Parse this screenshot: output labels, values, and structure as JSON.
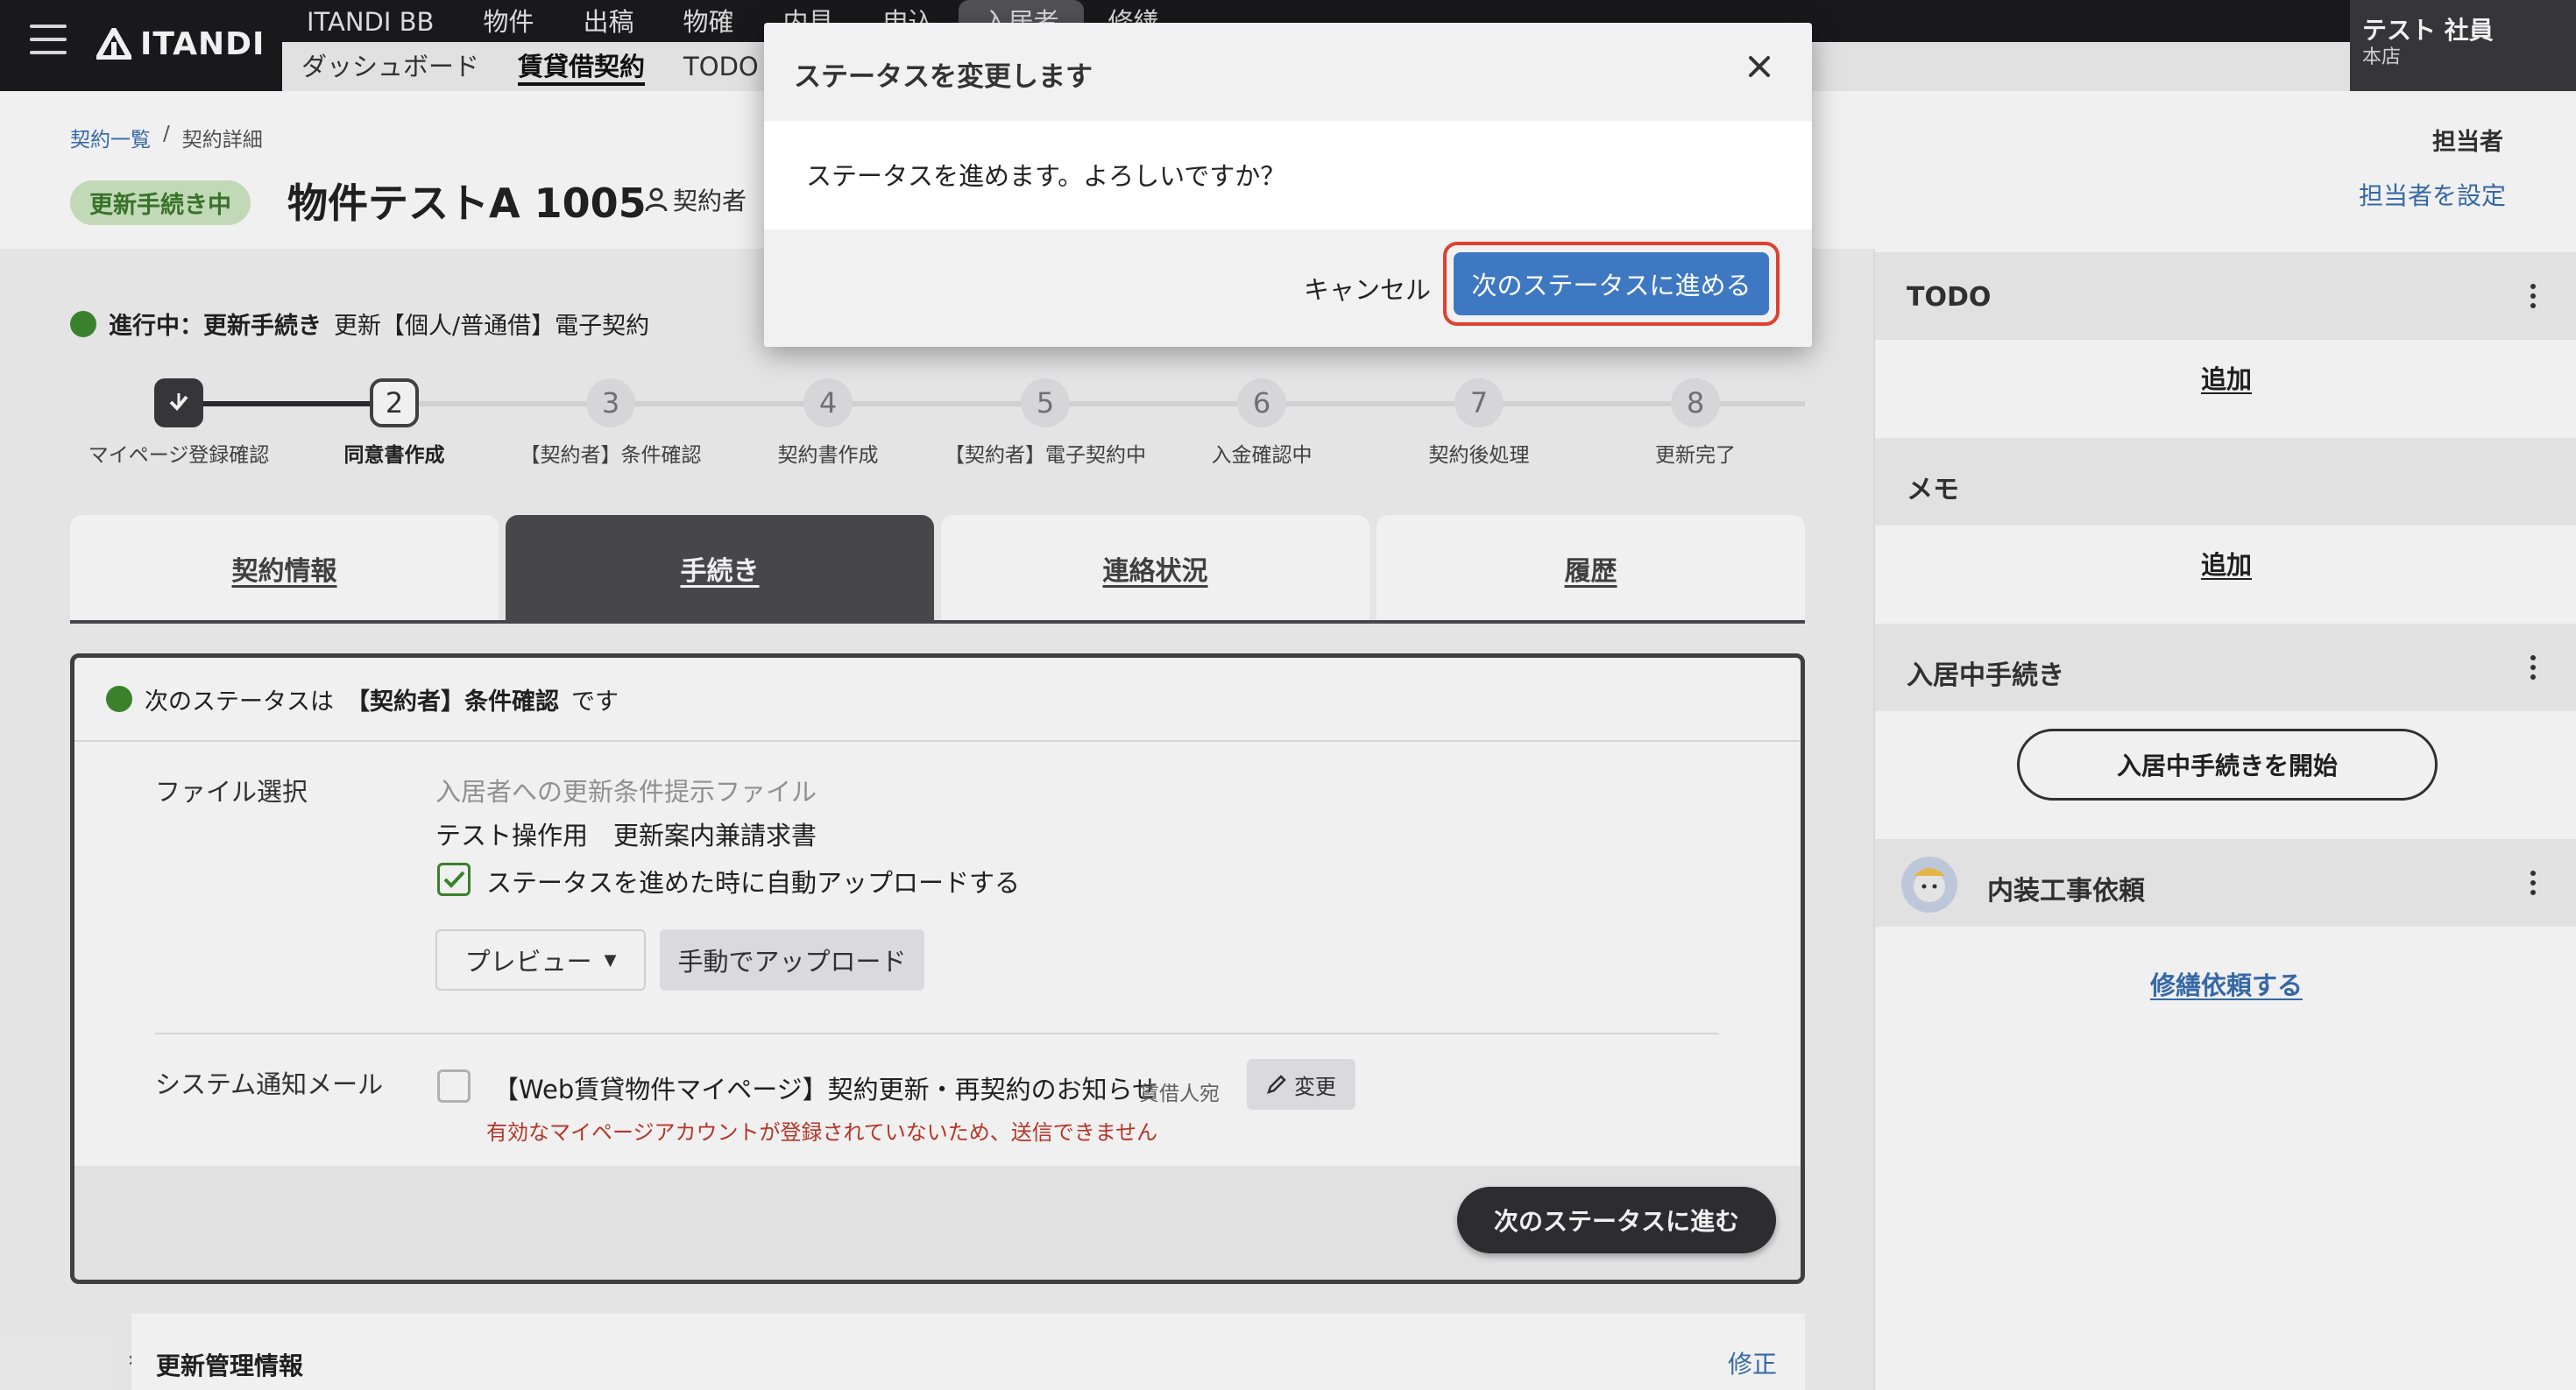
{
  "header": {
    "logo_text": "ITANDI",
    "nav_primary": [
      "ITANDI BB",
      "物件",
      "出稿",
      "物確",
      "内見",
      "申込",
      "入居者",
      "修繕"
    ],
    "nav_primary_active": 6,
    "nav_secondary": [
      "ダッシュボード",
      "賃貸借契約",
      "TODO"
    ],
    "nav_secondary_active": 1,
    "user_name": "テスト 社員",
    "user_branch": "本店"
  },
  "page": {
    "breadcrumb_list": "契約一覧",
    "breadcrumb_sep": "/",
    "breadcrumb_detail": "契約詳細",
    "status_chip": "更新手続き中",
    "title": "物件テストA 1005",
    "contractor_label": "契約者",
    "assignee_title": "担当者",
    "assignee_link": "担当者を設定"
  },
  "progress": {
    "state_label": "進行中：更新手続き",
    "state_detail": "更新【個人/普通借】電子契約",
    "steps": [
      {
        "num": "",
        "label": "マイページ登録確認",
        "state": "done"
      },
      {
        "num": "2",
        "label": "同意書作成",
        "state": "current"
      },
      {
        "num": "3",
        "label": "【契約者】条件確認",
        "state": "todo"
      },
      {
        "num": "4",
        "label": "契約書作成",
        "state": "todo"
      },
      {
        "num": "5",
        "label": "【契約者】電子契約中",
        "state": "todo"
      },
      {
        "num": "6",
        "label": "入金確認中",
        "state": "todo"
      },
      {
        "num": "7",
        "label": "契約後処理",
        "state": "todo"
      },
      {
        "num": "8",
        "label": "更新完了",
        "state": "todo"
      }
    ]
  },
  "tabs": [
    "契約情報",
    "手続き",
    "連絡状況",
    "履歴"
  ],
  "tabs_active": 1,
  "card": {
    "next_prefix": "次のステータスは",
    "next_status": "【契約者】条件確認",
    "next_suffix": "です",
    "file_label": "ファイル選択",
    "file_hint": "入居者への更新条件提示ファイル",
    "file_name": "テスト操作用　更新案内兼請求書",
    "auto_upload_label": "ステータスを進めた時に自動アップロードする",
    "auto_upload_checked": true,
    "preview_button": "プレビュー",
    "manual_upload_button": "手動でアップロード",
    "mail_label": "システム通知メール",
    "mail_title": "【Web賃貸物件マイページ】契約更新・再契約のお知らせ",
    "mail_recipient": "賃借人宛",
    "mail_change_button": "変更",
    "mail_warning": "有効なマイページアカウントが登録されていないため、送信できません",
    "mail_checked": false,
    "advance_button": "次のステータスに進む"
  },
  "bottom_section": {
    "title": "更新管理情報",
    "edit": "修正"
  },
  "sidebar": {
    "todo_title": "TODO",
    "todo_add": "追加",
    "memo_title": "メモ",
    "memo_add": "追加",
    "movein_title": "入居中手続き",
    "movein_button": "入居中手続きを開始",
    "interior_title": "内装工事依頼",
    "interior_link": "修繕依頼する"
  },
  "modal": {
    "title": "ステータスを変更します",
    "message": "ステータスを進めます。よろしいですか？",
    "cancel": "キャンセル",
    "confirm": "次のステータスに進める"
  },
  "colors": {
    "primary": "#3e78c2",
    "highlight": "#e0402f",
    "success": "#3d8b2e",
    "warning_text": "#c0392b"
  }
}
